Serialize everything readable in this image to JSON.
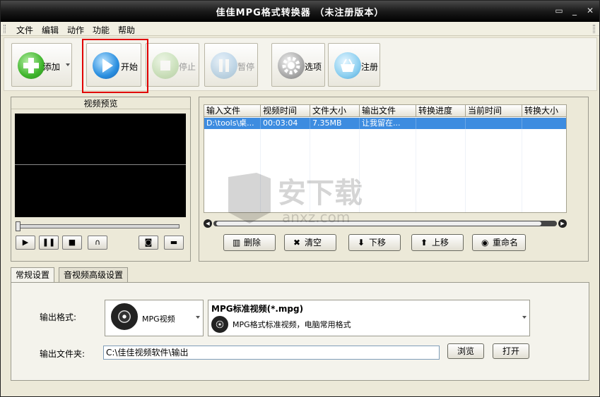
{
  "window": {
    "title": "佳佳MPG格式转换器  （未注册版本）"
  },
  "menu": [
    "文件",
    "编辑",
    "动作",
    "功能",
    "帮助"
  ],
  "toolbar": {
    "add": "添加",
    "start": "开始",
    "stop": "停止",
    "pause": "暂停",
    "options": "选项",
    "register": "注册"
  },
  "preview": {
    "title": "视频预览"
  },
  "file_list": {
    "columns": [
      "输入文件",
      "视频时间",
      "文件大小",
      "输出文件",
      "转换进度",
      "当前时间",
      "转换大小"
    ],
    "rows": [
      {
        "input": "D:\\tools\\桌...",
        "duration": "00:03:04",
        "size": "7.35MB",
        "output": "让我留在...",
        "progress": "",
        "current": "",
        "converted": ""
      }
    ]
  },
  "list_actions": {
    "delete": "删除",
    "clear": "清空",
    "down": "下移",
    "up": "上移",
    "rename": "重命名"
  },
  "tabs": [
    "常规设置",
    "音视频高级设置"
  ],
  "settings": {
    "format_label": "输出格式:",
    "format_value": "MPG视频",
    "profile_title": "MPG标准视频(*.mpg)",
    "profile_desc": "MPG格式标准视频，电脑常用格式",
    "folder_label": "输出文件夹:",
    "folder_value": "C:\\佳佳视频软件\\输出",
    "browse": "浏览",
    "open": "打开"
  },
  "watermark": {
    "text": "安下载",
    "sub": "anxz.com"
  }
}
